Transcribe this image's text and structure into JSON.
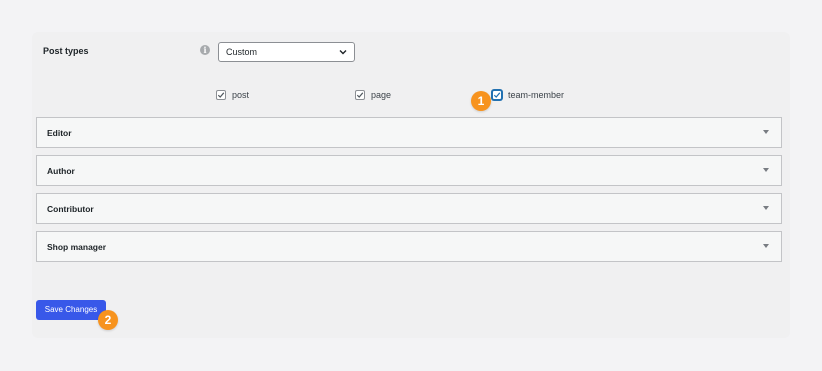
{
  "post_types": {
    "label": "Post types",
    "info_icon": "info-icon",
    "select_value": "Custom",
    "options": [
      {
        "label": "post",
        "checked": true
      },
      {
        "label": "page",
        "checked": true
      },
      {
        "label": "team-member",
        "checked": true
      }
    ]
  },
  "roles": [
    {
      "label": "Editor"
    },
    {
      "label": "Author"
    },
    {
      "label": "Contributor"
    },
    {
      "label": "Shop manager"
    }
  ],
  "save_button": {
    "label": "Save Changes"
  },
  "markers": [
    {
      "label": "1"
    },
    {
      "label": "2"
    }
  ],
  "colors": {
    "accent": "#3858e9",
    "marker": "#f7931e",
    "panel": "#f0f0f1"
  }
}
